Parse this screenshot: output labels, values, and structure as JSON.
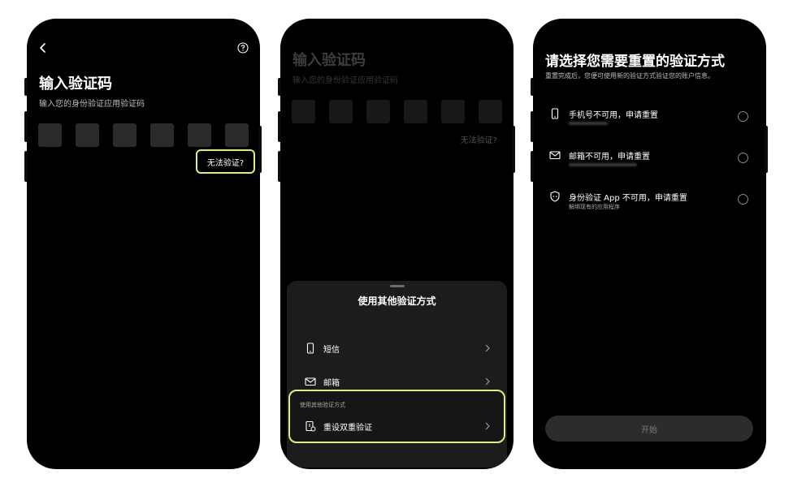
{
  "screen1": {
    "title": "输入验证码",
    "subtitle": "输入您的身份验证应用验证码",
    "cant_verify": "无法验证?"
  },
  "screen2": {
    "title": "输入验证码",
    "subtitle": "输入您的身份验证应用验证码",
    "cant_verify": "无法验证?",
    "sheet": {
      "title": "使用其他验证方式",
      "options": [
        {
          "label": "短信",
          "icon": "phone-icon"
        },
        {
          "label": "邮箱",
          "icon": "mail-icon"
        }
      ],
      "section_label": "使用其他验证方式",
      "reset_label": "重设双重验证",
      "reset_icon": "reset-2fa-icon"
    }
  },
  "screen3": {
    "title": "请选择您需要重置的验证方式",
    "subtitle": "重置完成后，您便可使用新的验证方式验证您的账户信息。",
    "options": [
      {
        "title": "手机号不可用，申请重置",
        "icon": "phone-icon"
      },
      {
        "title": "邮箱不可用，申请重置",
        "icon": "mail-icon"
      },
      {
        "title": "身份验证 App 不可用，申请重置",
        "subtitle": "解绑现有的应用程序",
        "icon": "shield-icon"
      }
    ],
    "start_button": "开始"
  },
  "colors": {
    "highlight": "#d7f27a",
    "background": "#000000",
    "code_box": "#2b2b2b"
  }
}
